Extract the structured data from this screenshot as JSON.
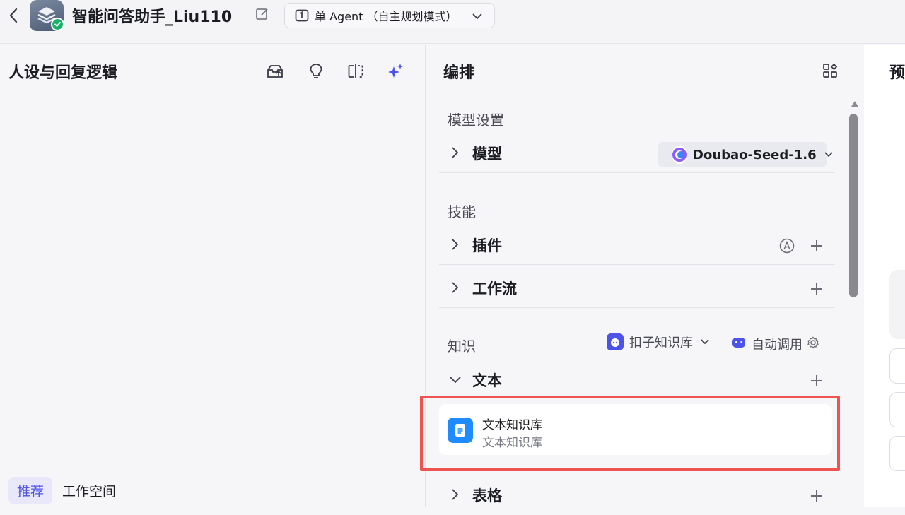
{
  "header": {
    "title": "智能问答助手_Liu110",
    "mode": "单 Agent （自主规划模式）"
  },
  "left_panel": {
    "title": "人设与回复逻辑",
    "tabs": [
      {
        "label": "推荐",
        "active": true
      },
      {
        "label": "工作空间",
        "active": false
      }
    ]
  },
  "orchestration": {
    "title": "编排",
    "model_settings": {
      "section_label": "模型设置",
      "model_row_label": "模型",
      "model_value": "Doubao-Seed-1.6"
    },
    "skills": {
      "section_label": "技能",
      "plugins_label": "插件",
      "workflow_label": "工作流"
    },
    "knowledge": {
      "section_label": "知识",
      "kb_source": "扣子知识库",
      "auto_call": "自动调用",
      "text_label": "文本",
      "text_item": {
        "title": "文本知识库",
        "subtitle": "文本知识库"
      },
      "table_label": "表格"
    }
  },
  "preview": {
    "title": "预"
  },
  "colors": {
    "accent": "#4d53e8",
    "highlight_border": "#ef5350",
    "kb_icon": "#1f8bff",
    "status_green": "#17b26a"
  }
}
